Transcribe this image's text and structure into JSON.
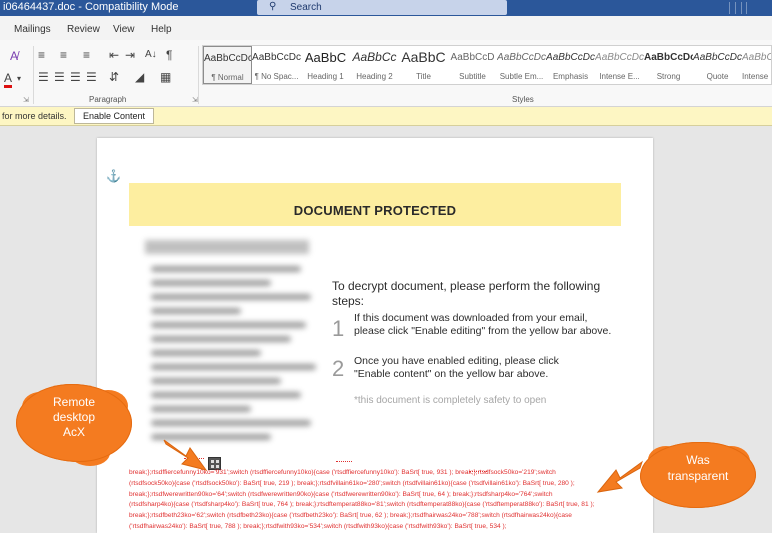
{
  "window": {
    "title": "i06464437.doc - Compatibility Mode",
    "search_placeholder": "Search"
  },
  "menu": {
    "items": [
      "Mailings",
      "Review",
      "View",
      "Help"
    ]
  },
  "ribbon": {
    "paragraph_label": "Paragraph",
    "styles_label": "Styles",
    "styles": [
      {
        "sample": "AaBbCcDc",
        "name": "¶ Normal"
      },
      {
        "sample": "AaBbCcDc",
        "name": "¶ No Spac..."
      },
      {
        "sample": "AaBbC",
        "name": "Heading 1"
      },
      {
        "sample": "AaBbCc",
        "name": "Heading 2"
      },
      {
        "sample": "AaBbC",
        "name": "Title"
      },
      {
        "sample": "AaBbCcD",
        "name": "Subtitle"
      },
      {
        "sample": "AaBbCcDc",
        "name": "Subtle Em..."
      },
      {
        "sample": "AaBbCcDc",
        "name": "Emphasis"
      },
      {
        "sample": "AaBbCcDc",
        "name": "Intense E..."
      },
      {
        "sample": "AaBbCcDc",
        "name": "Strong"
      },
      {
        "sample": "AaBbCcDc",
        "name": "Quote"
      },
      {
        "sample": "AaBbCcDc",
        "name": "Intense"
      }
    ]
  },
  "message_bar": {
    "text": "for more details.",
    "button": "Enable Content"
  },
  "document": {
    "banner_title": "DOCUMENT PROTECTED",
    "heading": "To decrypt document, please perform the following steps:",
    "steps": [
      {
        "num": "1",
        "text": "If this document was downloaded from your email, please click \"Enable editing\" from the yellow bar above."
      },
      {
        "num": "2",
        "text": "Once you have enabled editing, please click \"Enable content\" on the yellow bar above."
      }
    ],
    "note": "*this document is completely safety to open",
    "code_lines": [
      "break;};rtsdffiercefunny10ko='931';switch (rtsdffiercefunny10ko){case ('rtsdffiercefunny10ko'): BaSrt[ true, 931 ); break;};rtsdfsock50ko='219';switch",
      "(rtsdfsock50ko){case ('rtsdfsock50ko'): BaSrt[ true, 219 ); break;};rtsdfvillain61ko='280';switch (rtsdfvillain61ko){case ('rtsdfvillain61ko'): BaSrt[ true, 280 );",
      "break;};rtsdfwerewritten90ko='64';switch (rtsdfwerewritten90ko){case ('rtsdfwerewritten90ko'): BaSrt[ true, 64 ); break;};rtsdfsharp4ko='764';switch",
      "(rtsdfsharp4ko){case ('rtsdfsharp4ko'): BaSrt[ true, 764 ); break;};rtsdftemperat88ko='81';switch (rtsdftemperat88ko){case ('rtsdftemperat88ko'): BaSrt[ true, 81 );",
      "break;};rtsdfbeth23ko='62';switch (rtsdfbeth23ko){case ('rtsdfbeth23ko'): BaSrt[ true, 62 ); break;};rtsdfhairwas24ko='788';switch (rtsdfhairwas24ko){case",
      "('rtsdfhairwas24ko'): BaSrt[ true, 788 ); break;};rtsdfwith93ko='534';switch (rtsdfwith93ko){case ('rtsdfwith93ko'): BaSrt[ true, 534 );"
    ]
  },
  "callouts": {
    "left": [
      "Remote",
      "desktop",
      "AcX"
    ],
    "right": [
      "Was",
      "transparent"
    ]
  },
  "colors": {
    "titlebar": "#2b579a",
    "callout": "#f47b20",
    "banner": "#fdeea0",
    "code": "#e03030"
  }
}
